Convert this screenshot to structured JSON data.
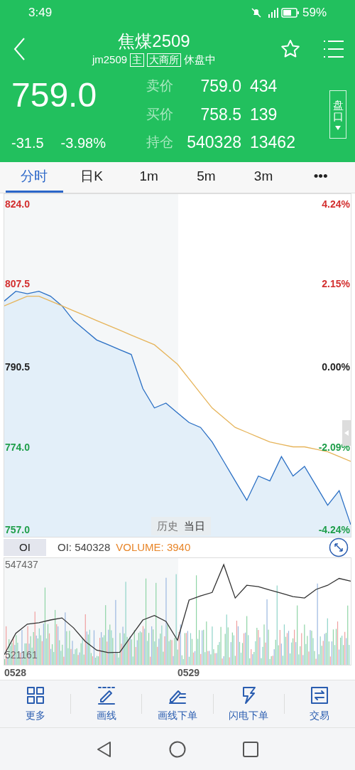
{
  "status_bar": {
    "time": "3:49",
    "battery": "59%"
  },
  "header": {
    "title": "焦煤2509",
    "code": "jm2509",
    "tags": [
      "主",
      "大商所"
    ],
    "session": "休盘中",
    "price": "759.0",
    "change": "-31.5",
    "change_pct": "-3.98%",
    "quotes": [
      {
        "label": "卖价",
        "price": "759.0",
        "qty": "434"
      },
      {
        "label": "买价",
        "price": "758.5",
        "qty": "139"
      },
      {
        "label": "持仓",
        "price": "540328",
        "qty": "13462"
      }
    ],
    "side_button": "盘口"
  },
  "tabs": [
    {
      "label": "分时",
      "selected": true
    },
    {
      "label": "日K",
      "selected": false
    },
    {
      "label": "1m",
      "selected": false
    },
    {
      "label": "5m",
      "selected": false
    },
    {
      "label": "3m",
      "selected": false
    },
    {
      "label": "•••",
      "selected": false
    }
  ],
  "price_chart": {
    "axis": [
      {
        "pct": "4.24%",
        "color": "#d32f2f"
      },
      {
        "pct": "2.15%",
        "color": "#d32f2f"
      },
      {
        "pct": "0.00%",
        "color": "#222222"
      },
      {
        "pct": "-2.09%",
        "color": "#1e9e4a"
      },
      {
        "pct": "-4.24%",
        "color": "#1e9e4a"
      }
    ],
    "chart_data": {
      "type": "line",
      "categories": [
        null,
        null,
        null,
        null,
        null,
        null,
        null,
        null,
        null,
        null,
        null,
        null,
        null,
        null,
        null,
        null,
        null,
        null,
        null,
        null,
        null,
        null,
        null,
        null,
        null,
        null,
        null,
        null,
        null,
        null,
        null
      ],
      "ylim": [
        755.5,
        826
      ],
      "yticks": [
        {
          "value": 824,
          "label": "824.0"
        },
        {
          "value": 807.5,
          "label": "807.5"
        },
        {
          "value": 790.5,
          "label": "790.5"
        },
        {
          "value": 774,
          "label": "774.0"
        },
        {
          "value": 757,
          "label": "757.0"
        }
      ],
      "series": [
        {
          "color": "#2a6fc4",
          "values": [
            804,
            806,
            805.5,
            806,
            805,
            803,
            800,
            798,
            796,
            795,
            794,
            793,
            786,
            782,
            783,
            781,
            779,
            778,
            775,
            771,
            767,
            763,
            768,
            767,
            772,
            768,
            770,
            766,
            762,
            765,
            758
          ]
        },
        {
          "color": "#e6b45a",
          "values": [
            803,
            804,
            805,
            805,
            804,
            803,
            802,
            801,
            800,
            799,
            798,
            797,
            796,
            795,
            793,
            791,
            788,
            785,
            782,
            780,
            778,
            777,
            776,
            775,
            774.5,
            774,
            774,
            773.5,
            773,
            772,
            771
          ]
        }
      ]
    },
    "toggle": [
      {
        "label": "历史",
        "selected": false
      },
      {
        "label": "当日",
        "selected": true
      }
    ]
  },
  "indicator_bar": {
    "selector": "OI",
    "oi": "OI: 540328",
    "volume": "VOLUME: 3940"
  },
  "oi_chart": {
    "dates": [
      "0528",
      "0529"
    ],
    "chart_data": {
      "type": "line",
      "categories": [
        null,
        null,
        null,
        null,
        null,
        null,
        null,
        null,
        null,
        null,
        null,
        null,
        null,
        null,
        null,
        null,
        null,
        null,
        null,
        null,
        null,
        null,
        null,
        null,
        null,
        null,
        null,
        null,
        null,
        null,
        null
      ],
      "ylim": [
        518264,
        549299
      ],
      "yticks": [
        {
          "value": 547437,
          "label": "547437"
        },
        {
          "value": 521161,
          "label": "521161"
        }
      ],
      "series": [
        {
          "color": "#333333",
          "values": [
            521200,
            527400,
            530100,
            530500,
            531300,
            531900,
            529000,
            525100,
            522500,
            521800,
            521900,
            526600,
            531300,
            532600,
            530900,
            525400,
            537100,
            538300,
            539300,
            547400,
            537700,
            541400,
            541000,
            540000,
            539100,
            538100,
            537700,
            540200,
            541400,
            543400,
            542600
          ]
        }
      ]
    }
  },
  "toolbar": [
    {
      "label": "更多",
      "kind": "grid"
    },
    {
      "label": "画线",
      "kind": "pen"
    },
    {
      "label": "画线下单",
      "kind": "pen-lines"
    },
    {
      "label": "闪电下单",
      "kind": "bolt"
    },
    {
      "label": "交易",
      "kind": "exchange"
    }
  ]
}
